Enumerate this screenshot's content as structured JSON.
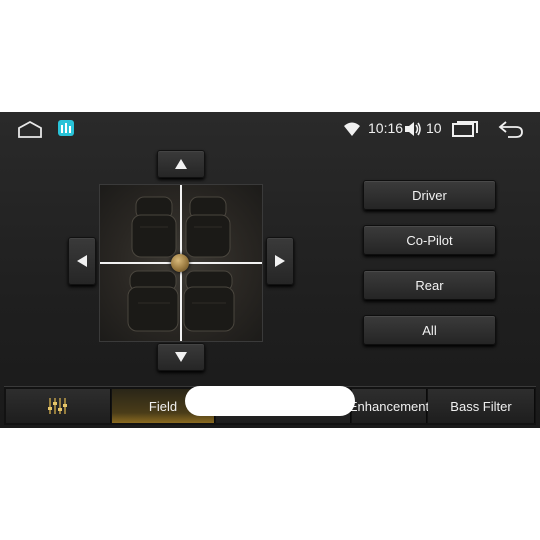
{
  "status_bar": {
    "time": "10:16",
    "volume": "10",
    "icons": {
      "home": "home-icon",
      "app": "equalizer-app-icon",
      "wifi": "wifi-icon",
      "volume": "speaker-icon",
      "recents": "recent-apps-icon",
      "back": "back-arrow-icon"
    },
    "app_color": "#29c3d8"
  },
  "field_pad": {
    "image": "car-seats-top-view",
    "arrows": [
      "up",
      "down",
      "left",
      "right"
    ]
  },
  "presets": [
    {
      "label": "Driver"
    },
    {
      "label": "Co-Pilot"
    },
    {
      "label": "Rear"
    },
    {
      "label": "All"
    }
  ],
  "tabs": {
    "eq_icon": "equalizer-sliders-icon",
    "field": "Field",
    "enhancement": "Enhancement",
    "bass_filter": "Bass Filter",
    "active": "Field"
  },
  "colors": {
    "accent": "#8a6a20",
    "knob": "#b89550",
    "background": "#222222"
  }
}
